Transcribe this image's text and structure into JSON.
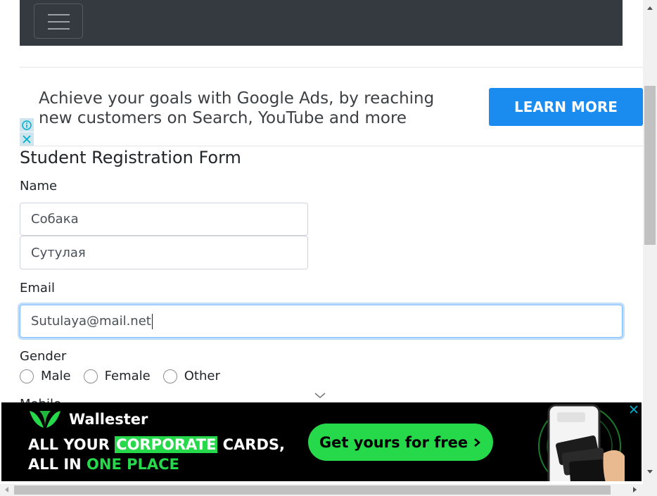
{
  "navbar": {
    "toggler_icon": "hamburger-icon"
  },
  "google_ad": {
    "text_line1": "Achieve your goals with Google Ads, by reaching",
    "text_line2": "new customers on Search, YouTube and more",
    "cta": "LEARN MORE",
    "cta_color": "#1a8cf0",
    "info_icon": "info-icon",
    "close_icon": "close-icon"
  },
  "form": {
    "title": "Student Registration Form",
    "name_label": "Name",
    "first_name_value": "Собака",
    "last_name_value": "Сутулая",
    "email_label": "Email",
    "email_value": "Sutulaya@mail.net",
    "gender_label": "Gender",
    "gender_options": [
      "Male",
      "Female",
      "Other"
    ],
    "next_label": "Mobile"
  },
  "wallester_ad": {
    "brand": "Wallester",
    "line1_prefix": "ALL YOUR ",
    "line1_highlight": "CORPORATE",
    "line1_suffix": " CARDS,",
    "line2_prefix": "ALL IN ",
    "line2_highlight": "ONE PLACE",
    "cta": "Get yours for free",
    "accent_color": "#26d94a"
  }
}
